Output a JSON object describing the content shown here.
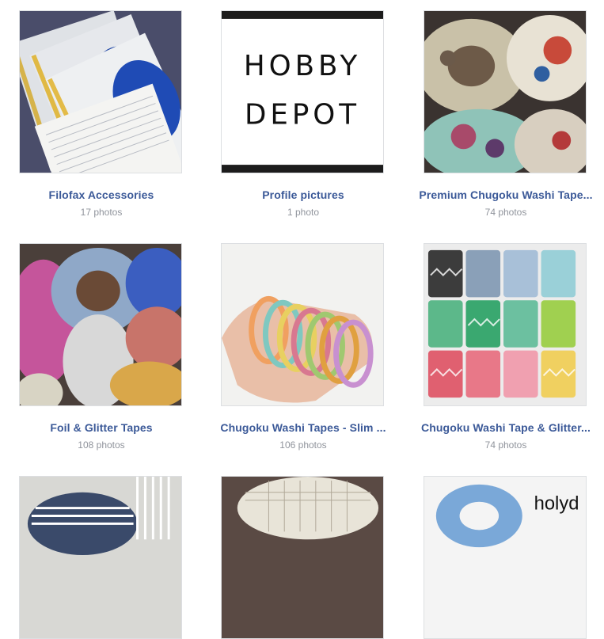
{
  "albums": [
    {
      "title": "Filofax Accessories",
      "count": "17 photos"
    },
    {
      "title": "Profile pictures",
      "count": "1 photo"
    },
    {
      "title": "Premium Chugoku Washi Tape...",
      "count": "74 photos"
    },
    {
      "title": "Foil & Glitter Tapes",
      "count": "108 photos"
    },
    {
      "title": "Chugoku Washi Tapes - Slim ...",
      "count": "106 photos"
    },
    {
      "title": "Chugoku Washi Tape & Glitter...",
      "count": "74 photos"
    }
  ],
  "logo": {
    "line1": "HOBBY",
    "line2": "DEPOT"
  },
  "partial_text": "holyd"
}
